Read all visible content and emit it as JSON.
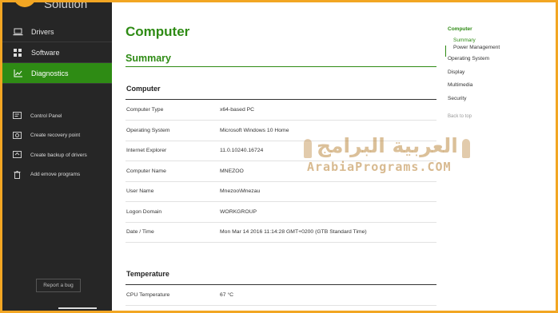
{
  "app": {
    "title": "Solution"
  },
  "sidebar": {
    "nav": [
      {
        "label": "Drivers",
        "icon": "laptop-icon",
        "active": false
      },
      {
        "label": "Software",
        "icon": "grid-icon",
        "active": false
      },
      {
        "label": "Diagnostics",
        "icon": "chart-icon",
        "active": true
      }
    ],
    "tools": [
      {
        "label": "Control Panel",
        "icon": "control-panel-icon"
      },
      {
        "label": "Create recovery point",
        "icon": "recovery-icon"
      },
      {
        "label": "Create backup of drivers",
        "icon": "backup-icon"
      },
      {
        "label": "Add emove programs",
        "icon": "trash-icon"
      }
    ],
    "report_label": "Report a bug"
  },
  "main": {
    "title": "Computer",
    "section": "Summary",
    "groups": [
      {
        "title": "Computer",
        "rows": [
          {
            "key": "Computer Type",
            "value": "x64-based PC"
          },
          {
            "key": "Operating System",
            "value": "Microsoft Windows 10 Home"
          },
          {
            "key": "Internet Explorer",
            "value": "11.0.10240.16724"
          },
          {
            "key": "Computer Name",
            "value": "MNEZOO"
          },
          {
            "key": "User Name",
            "value": "Mnezoo\\Mnezau"
          },
          {
            "key": "Logon Domain",
            "value": "WORKGROUP"
          },
          {
            "key": "Date / Time",
            "value": "Mon Mar 14 2016 11:14:28 GMT+0200 (GTB Standard Time)"
          }
        ]
      },
      {
        "title": "Temperature",
        "rows": [
          {
            "key": "CPU Temperature",
            "value": "67 °C"
          }
        ]
      }
    ]
  },
  "toc": {
    "items": [
      {
        "label": "Computer",
        "active": true
      },
      {
        "label": "Summary",
        "active": true
      },
      {
        "label": "Power Management",
        "active": false
      },
      {
        "label": "Operating System",
        "active": false
      },
      {
        "label": "Display",
        "active": false
      },
      {
        "label": "Multimedia",
        "active": false
      },
      {
        "label": "Security",
        "active": false
      },
      {
        "label": "Back to top",
        "active": false
      }
    ]
  },
  "watermark": {
    "arabic": "العربية البرامج",
    "latin": "ArabiaPrograms.COM"
  },
  "colors": {
    "accent": "#2e8b14",
    "sidebar": "#262626",
    "border": "#f2a623"
  }
}
